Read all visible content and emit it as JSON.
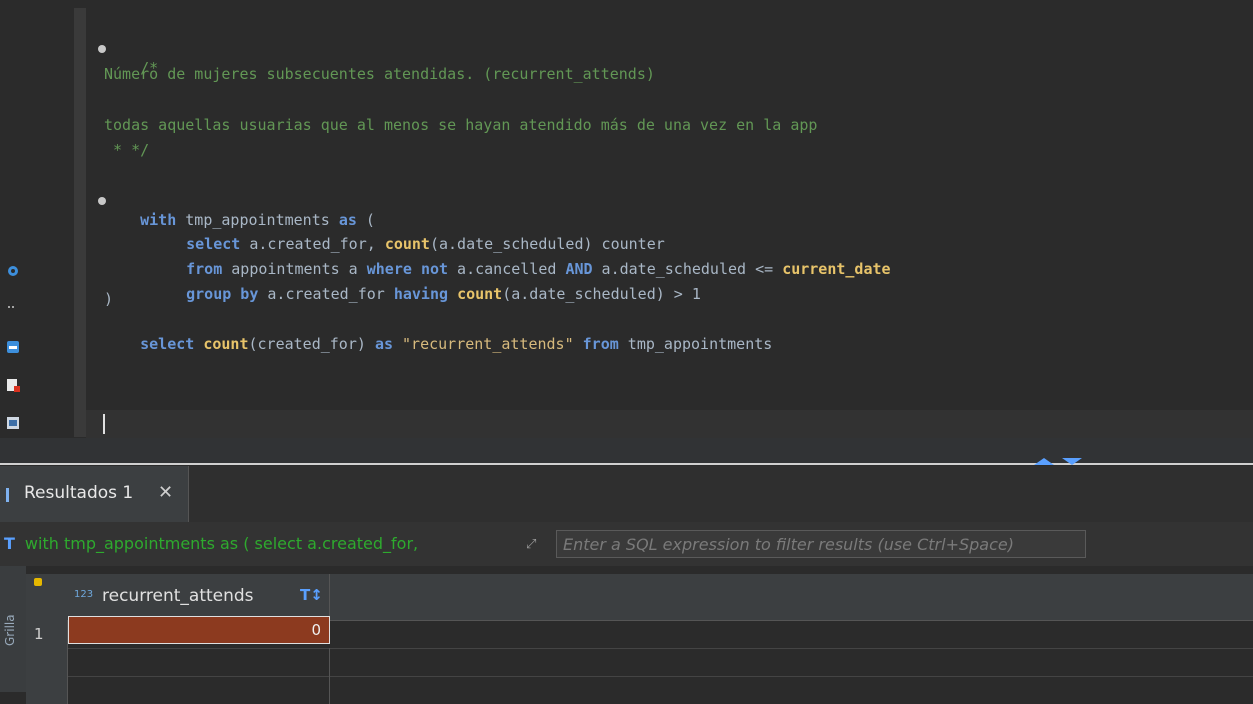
{
  "colors": {
    "comment": "#629755",
    "keyword": "#6896d8",
    "function": "#e8c46a",
    "string": "#d7ba7d",
    "selected_cell": "#8c3a1f",
    "query_preview": "#2eaa2e"
  },
  "left_toolbar": {
    "icons": [
      "settings-icon",
      "more-icon",
      "save-icon",
      "script-error-icon",
      "output-icon"
    ]
  },
  "editor": {
    "comment_open": "/*",
    "comment_line1": "Número de mujeres subsecuentes atendidas. (recurrent_attends)",
    "comment_line2": "todas aquellas usuarias que al menos se hayan atendido más de una vez en la app",
    "comment_close": " * */",
    "cte": {
      "with": "with",
      "name": " tmp_appointments ",
      "as": "as",
      "open": " ("
    },
    "line_select": {
      "select": "select",
      "rest1": " a.created_for, ",
      "count": "count",
      "rest2": "(a.date_scheduled) counter"
    },
    "line_from": {
      "from": "from",
      "rest1": " appointments a ",
      "where": "where",
      "sp1": " ",
      "not": "not",
      "rest2": " a.cancelled ",
      "and": "AND",
      "rest3": " a.date_scheduled <= ",
      "current_date": "current_date"
    },
    "line_group": {
      "group_by": "group by",
      "rest1": " a.created_for ",
      "having": "having",
      "sp": " ",
      "count": "count",
      "rest2": "(a.date_scheduled) > 1"
    },
    "close_paren": ")",
    "line_final": {
      "select": "select",
      "sp": " ",
      "count": "count",
      "rest1": "(created_for) ",
      "as": "as",
      "sp2": " ",
      "alias": "\"recurrent_attends\"",
      "sp3": " ",
      "from": "from",
      "rest2": " tmp_appointments"
    }
  },
  "results": {
    "tab_label": "Resultados 1",
    "close_glyph": "✕",
    "query_type_glyph": "T",
    "query_preview": "with tmp_appointments as ( select a.created_for,",
    "filter_placeholder": "Enter a SQL expression to filter results (use Ctrl+Space)",
    "side_label": "Grilla",
    "column": {
      "type_label": "123",
      "header": "recurrent_attends",
      "sort_glyph": "T↕"
    },
    "rows": [
      {
        "num": "1",
        "value": "0"
      }
    ]
  }
}
